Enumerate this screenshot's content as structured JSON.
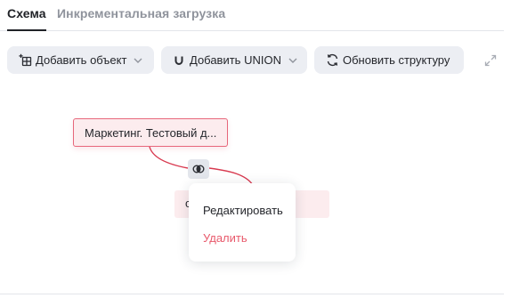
{
  "tabs": [
    {
      "label": "Схема",
      "active": true
    },
    {
      "label": "Инкрементальная загрузка",
      "active": false
    }
  ],
  "toolbar": {
    "add_object": {
      "label": "Добавить объект",
      "icon": "add-table-icon"
    },
    "add_union": {
      "label": "Добавить UNION",
      "icon": "union-icon"
    },
    "refresh": {
      "label": "Обновить структуру",
      "icon": "refresh-icon"
    },
    "expand_icon": "expand-icon"
  },
  "canvas": {
    "nodes": [
      {
        "label": "Маркетинг. Тестовый д..."
      },
      {
        "label": "с"
      }
    ],
    "join_icon": "join-type-icon"
  },
  "context_menu": {
    "items": [
      {
        "label": "Редактировать"
      },
      {
        "label": "Удалить"
      }
    ]
  },
  "colors": {
    "accent_danger": "#e8596b",
    "node_border": "#e7677b",
    "node_fill": "#fcecee",
    "button_bg": "#eceef3"
  }
}
